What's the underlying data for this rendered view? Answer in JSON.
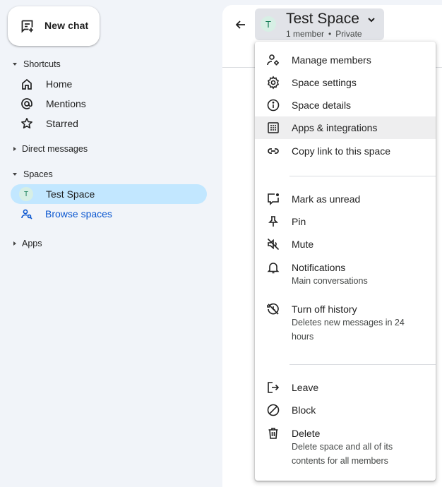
{
  "sidebar": {
    "new_chat_label": "New chat",
    "shortcuts": {
      "header": "Shortcuts",
      "items": [
        {
          "label": "Home",
          "icon": "home-icon"
        },
        {
          "label": "Mentions",
          "icon": "at-sign-icon"
        },
        {
          "label": "Starred",
          "icon": "star-icon"
        }
      ]
    },
    "direct_messages_header": "Direct messages",
    "spaces": {
      "header": "Spaces",
      "items": [
        {
          "label": "Test Space",
          "avatar": "T",
          "active": true
        },
        {
          "label": "Browse spaces",
          "icon": "browse-spaces-icon"
        }
      ]
    },
    "apps_header": "Apps"
  },
  "header": {
    "space_avatar": "T",
    "space_title": "Test Space",
    "member_count": "1 member",
    "visibility": "Private",
    "separator": "•"
  },
  "menu": {
    "items": [
      {
        "label": "Manage members",
        "icon": "manage-members-icon"
      },
      {
        "label": "Space settings",
        "icon": "gear-icon"
      },
      {
        "label": "Space details",
        "icon": "info-icon"
      },
      {
        "label": "Apps & integrations",
        "icon": "apps-grid-icon",
        "highlighted": true
      },
      {
        "label": "Copy link to this space",
        "icon": "link-icon"
      },
      {
        "label": "Mark as unread",
        "icon": "mark-unread-icon"
      },
      {
        "label": "Pin",
        "icon": "pin-icon"
      },
      {
        "label": "Mute",
        "icon": "mute-icon"
      },
      {
        "label": "Notifications",
        "sub": "Main conversations",
        "icon": "bell-icon"
      },
      {
        "label": "Turn off history",
        "sub": "Deletes new messages in 24 hours",
        "icon": "history-off-icon"
      },
      {
        "label": "Leave",
        "icon": "leave-icon"
      },
      {
        "label": "Block",
        "icon": "block-icon"
      },
      {
        "label": "Delete",
        "sub": "Delete space and all of its contents for all members",
        "icon": "trash-icon"
      }
    ]
  },
  "colors": {
    "sidebar_bg": "#f1f4f9",
    "active_item": "#c2e7ff",
    "link_blue": "#0b57d0",
    "avatar_bg": "#d7efe5",
    "avatar_fg": "#0f7a53"
  }
}
